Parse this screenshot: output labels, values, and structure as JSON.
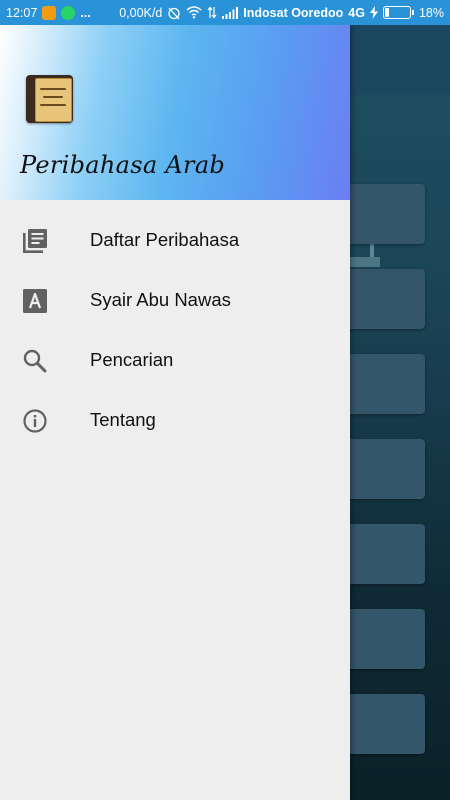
{
  "status_bar": {
    "time": "12:07",
    "more": "...",
    "speed": "0,00K/d",
    "carrier": "Indosat Ooredoo",
    "network": "4G",
    "battery": "18%",
    "battery_level": 0.18
  },
  "drawer": {
    "app_title": "Peribahasa Arab",
    "logo_icon": "book-logo-icon",
    "items": [
      {
        "label": "Daftar Peribahasa",
        "icon": "list-icon"
      },
      {
        "label": "Syair Abu Nawas",
        "icon": "font-a-icon"
      },
      {
        "label": "Pencarian",
        "icon": "search-icon"
      },
      {
        "label": "Tentang",
        "icon": "info-icon"
      }
    ]
  },
  "colors": {
    "status_bar": "#2a93d8",
    "drawer_bg": "#eeeeee",
    "icon": "#616161",
    "text": "#111111"
  }
}
